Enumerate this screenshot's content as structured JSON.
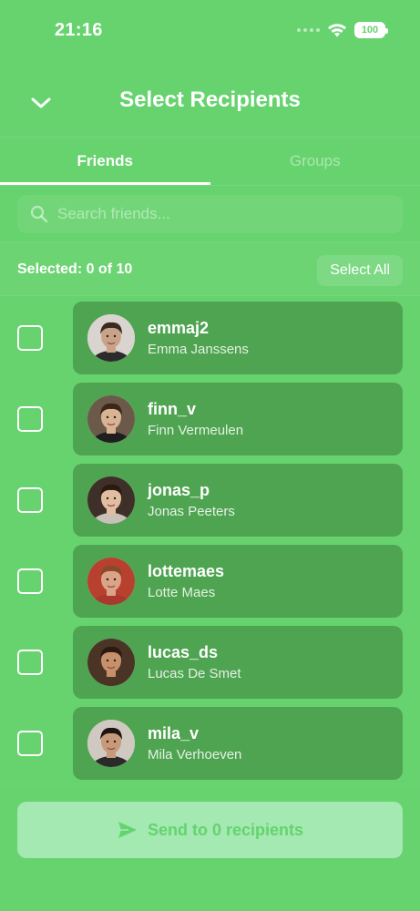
{
  "status_bar": {
    "time": "21:16",
    "battery": "100",
    "icons": [
      "signal-dots-icon",
      "wifi-icon",
      "battery-icon"
    ]
  },
  "header": {
    "title": "Select Recipients",
    "back_icon": "chevron-down-icon"
  },
  "tabs": [
    {
      "label": "Friends",
      "active": true
    },
    {
      "label": "Groups",
      "active": false
    }
  ],
  "search": {
    "placeholder": "Search friends...",
    "value": "",
    "icon": "search-icon"
  },
  "selection": {
    "selected_text": "Selected: 0 of 10",
    "select_all_label": "Select All"
  },
  "friends": [
    {
      "username": "emmaj2",
      "name": "Emma Janssens",
      "checked": false,
      "avatar_colors": {
        "bg": "#d9d4cf",
        "skin": "#c9a389",
        "hair": "#3a2a20",
        "shirt": "#2b2b2b"
      }
    },
    {
      "username": "finn_v",
      "name": "Finn Vermeulen",
      "checked": false,
      "avatar_colors": {
        "bg": "#6b5a4a",
        "skin": "#d8b394",
        "hair": "#3b2618",
        "shirt": "#1f1f1f"
      }
    },
    {
      "username": "jonas_p",
      "name": "Jonas Peeters",
      "checked": false,
      "avatar_colors": {
        "bg": "#3e3028",
        "skin": "#e1bea1",
        "hair": "#2a1a12",
        "shirt": "#c9c1b8"
      }
    },
    {
      "username": "lottemaes",
      "name": "Lotte Maes",
      "checked": false,
      "avatar_colors": {
        "bg": "#b8402f",
        "skin": "#dba387",
        "hair": "#8a4a2a",
        "shirt": "#a8392c"
      }
    },
    {
      "username": "lucas_ds",
      "name": "Lucas De Smet",
      "checked": false,
      "avatar_colors": {
        "bg": "#4a3426",
        "skin": "#c6906b",
        "hair": "#2c1a12",
        "shirt": "#4a3426"
      }
    },
    {
      "username": "mila_v",
      "name": "Mila Verhoeven",
      "checked": false,
      "avatar_colors": {
        "bg": "#cfc9c2",
        "skin": "#c79a7c",
        "hair": "#1e1410",
        "shirt": "#2a2a2a"
      }
    }
  ],
  "send_button": {
    "label": "Send to 0 recipients",
    "icon": "send-icon"
  },
  "colors": {
    "background": "#66d36e",
    "card": "#4fa451",
    "send_button_bg": "#a4e8b2",
    "send_button_text": "#63d46d"
  }
}
